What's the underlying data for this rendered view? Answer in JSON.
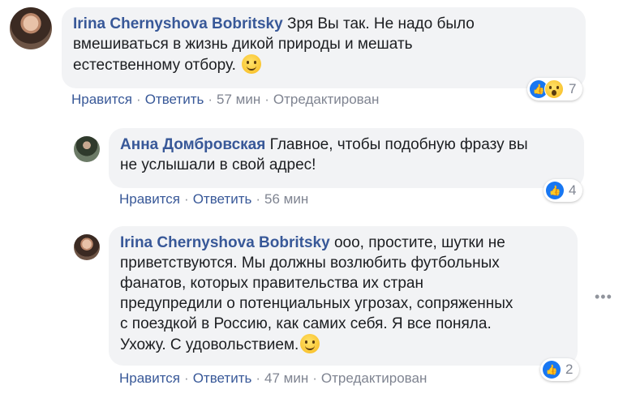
{
  "comments": [
    {
      "author": "Irina Chernyshova Bobritsky",
      "text": "Зря Вы так. Не надо было\nвмешиваться в жизнь дикой природы и мешать\nестественному отбору. ",
      "actions": {
        "like": "Нравится",
        "reply": "Ответить",
        "time": "57 мин",
        "edited": "Отредактирован"
      },
      "reactions": {
        "icons": [
          "like-icon",
          "wow-icon"
        ],
        "count": "7"
      }
    },
    {
      "author": "Анна Домбровская",
      "text": "Главное, чтобы подобную фразу вы\nне услышали в свой адрес!",
      "actions": {
        "like": "Нравится",
        "reply": "Ответить",
        "time": "56 мин"
      },
      "reactions": {
        "icons": [
          "like-icon"
        ],
        "count": "4"
      }
    },
    {
      "author": "Irina Chernyshova Bobritsky",
      "text": "ооо, простите, шутки не\nприветствуются. Мы должны возлюбить футбольных\nфанатов, которых правительства их стран\nпредупредили о потенциальных угрозах, сопряженных\nс поездкой в Россию, как самих себя. Я все поняла.\nУхожу. С удовольствием.",
      "actions": {
        "like": "Нравится",
        "reply": "Ответить",
        "time": "47 мин",
        "edited": "Отредактирован"
      },
      "reactions": {
        "icons": [
          "like-icon"
        ],
        "count": "2"
      }
    }
  ],
  "separator": "·",
  "more_options": "•••",
  "like_glyph": "👍",
  "colors": {
    "link": "#385898",
    "bubble": "#f2f3f5",
    "meta": "#7f8491",
    "like": "#1877f2"
  }
}
